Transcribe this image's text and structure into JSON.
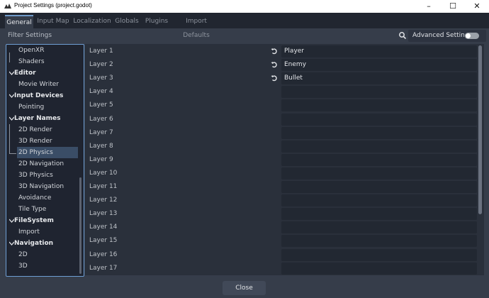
{
  "window": {
    "title": "Project Settings (project.godot)",
    "controls": [
      "minimize",
      "maximize",
      "close"
    ]
  },
  "tabs": [
    {
      "label": "General",
      "active": true
    },
    {
      "label": "Input Map",
      "active": false
    },
    {
      "label": "Localization",
      "active": false
    },
    {
      "label": "Globals",
      "active": false
    },
    {
      "label": "Plugins",
      "active": false
    },
    {
      "label": "Import Defaults",
      "active": false
    }
  ],
  "filter": {
    "placeholder": "Filter Settings"
  },
  "advanced_settings": {
    "label": "Advanced Settings",
    "enabled": false
  },
  "sidebar": {
    "items": [
      {
        "label": "OpenXR",
        "type": "child"
      },
      {
        "label": "Shaders",
        "type": "child"
      },
      {
        "label": "Editor",
        "type": "section"
      },
      {
        "label": "Movie Writer",
        "type": "child"
      },
      {
        "label": "Input Devices",
        "type": "section"
      },
      {
        "label": "Pointing",
        "type": "child"
      },
      {
        "label": "Layer Names",
        "type": "section"
      },
      {
        "label": "2D Render",
        "type": "child"
      },
      {
        "label": "3D Render",
        "type": "child"
      },
      {
        "label": "2D Physics",
        "type": "child",
        "selected": true
      },
      {
        "label": "2D Navigation",
        "type": "child"
      },
      {
        "label": "3D Physics",
        "type": "child"
      },
      {
        "label": "3D Navigation",
        "type": "child"
      },
      {
        "label": "Avoidance",
        "type": "child"
      },
      {
        "label": "Tile Type",
        "type": "child"
      },
      {
        "label": "FileSystem",
        "type": "section"
      },
      {
        "label": "Import",
        "type": "child"
      },
      {
        "label": "Navigation",
        "type": "section"
      },
      {
        "label": "2D",
        "type": "child"
      },
      {
        "label": "3D",
        "type": "child"
      }
    ]
  },
  "layers": [
    {
      "label": "Layer 1",
      "value": "Player",
      "modified": true
    },
    {
      "label": "Layer 2",
      "value": "Enemy",
      "modified": true
    },
    {
      "label": "Layer 3",
      "value": "Bullet",
      "modified": true
    },
    {
      "label": "Layer 4",
      "value": "",
      "modified": false
    },
    {
      "label": "Layer 5",
      "value": "",
      "modified": false
    },
    {
      "label": "Layer 6",
      "value": "",
      "modified": false
    },
    {
      "label": "Layer 7",
      "value": "",
      "modified": false
    },
    {
      "label": "Layer 8",
      "value": "",
      "modified": false
    },
    {
      "label": "Layer 9",
      "value": "",
      "modified": false
    },
    {
      "label": "Layer 10",
      "value": "",
      "modified": false
    },
    {
      "label": "Layer 11",
      "value": "",
      "modified": false
    },
    {
      "label": "Layer 12",
      "value": "",
      "modified": false
    },
    {
      "label": "Layer 13",
      "value": "",
      "modified": false
    },
    {
      "label": "Layer 14",
      "value": "",
      "modified": false
    },
    {
      "label": "Layer 15",
      "value": "",
      "modified": false
    },
    {
      "label": "Layer 16",
      "value": "",
      "modified": false
    },
    {
      "label": "Layer 17",
      "value": "",
      "modified": false
    }
  ],
  "footer": {
    "close_label": "Close"
  },
  "colors": {
    "accent": "#6e9ed4",
    "selection": "#3a4d66",
    "background": "#363d4a"
  }
}
